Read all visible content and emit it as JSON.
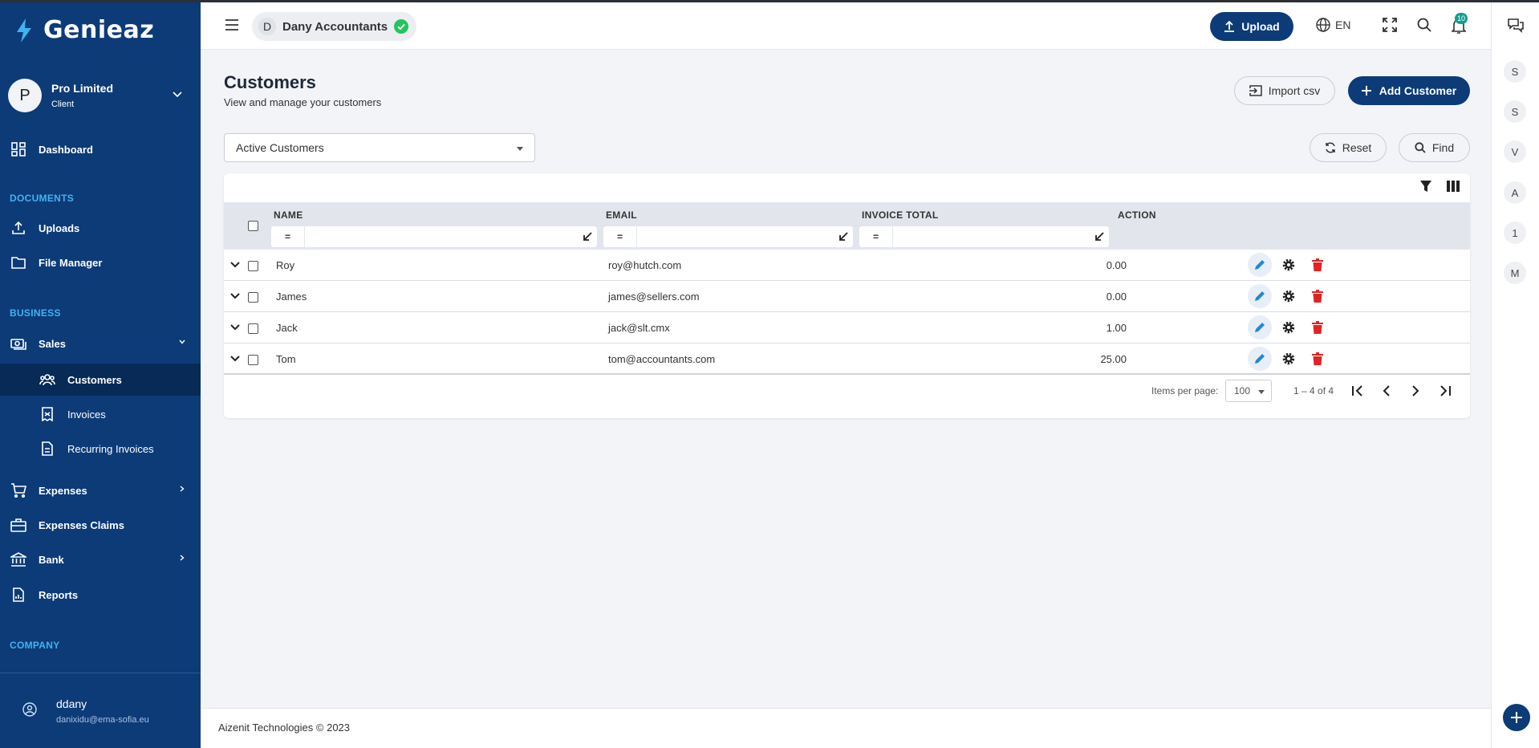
{
  "brand": {
    "name": "Genieaz"
  },
  "org": {
    "initial": "P",
    "name": "Pro Limited",
    "role": "Client"
  },
  "sidebar": {
    "dashboard": "Dashboard",
    "section_documents": "DOCUMENTS",
    "uploads": "Uploads",
    "file_manager": "File Manager",
    "section_business": "BUSINESS",
    "sales": "Sales",
    "customers": "Customers",
    "invoices": "Invoices",
    "recurring_invoices": "Recurring Invoices",
    "expenses": "Expenses",
    "expenses_claims": "Expenses Claims",
    "bank": "Bank",
    "reports": "Reports",
    "section_company": "COMPANY"
  },
  "user": {
    "name": "ddany",
    "email": "danixidu@ema-sofia.eu"
  },
  "header": {
    "company_initial": "D",
    "company_name": "Dany Accountants",
    "upload_label": "Upload",
    "language": "EN",
    "notification_count": "10"
  },
  "rail": {
    "avatars": [
      "S",
      "S",
      "V",
      "A",
      "1",
      "M"
    ]
  },
  "page": {
    "title": "Customers",
    "subtitle": "View and manage your customers",
    "import_label": "Import csv",
    "add_label": "Add Customer",
    "filter_selected": "Active Customers",
    "reset_label": "Reset",
    "find_label": "Find"
  },
  "table": {
    "columns": {
      "name": "NAME",
      "email": "EMAIL",
      "invoice_total": "INVOICE TOTAL",
      "action": "ACTION"
    },
    "filter_operator": "=",
    "rows": [
      {
        "name": "Roy",
        "email": "roy@hutch.com",
        "invoice_total": "0.00"
      },
      {
        "name": "James",
        "email": "james@sellers.com",
        "invoice_total": "0.00"
      },
      {
        "name": "Jack",
        "email": "jack@slt.cmx",
        "invoice_total": "1.00"
      },
      {
        "name": "Tom",
        "email": "tom@accountants.com",
        "invoice_total": "25.00"
      }
    ],
    "pagination": {
      "items_per_page_label": "Items per page:",
      "items_per_page": "100",
      "range": "1 – 4 of 4"
    }
  },
  "footer": {
    "text": "Aizenit Technologies © 2023"
  },
  "colors": {
    "primary": "#0c3b78",
    "accent": "#3fb3f0",
    "danger": "#e02424",
    "success": "#22c55e",
    "edit": "#1f8ad8"
  }
}
